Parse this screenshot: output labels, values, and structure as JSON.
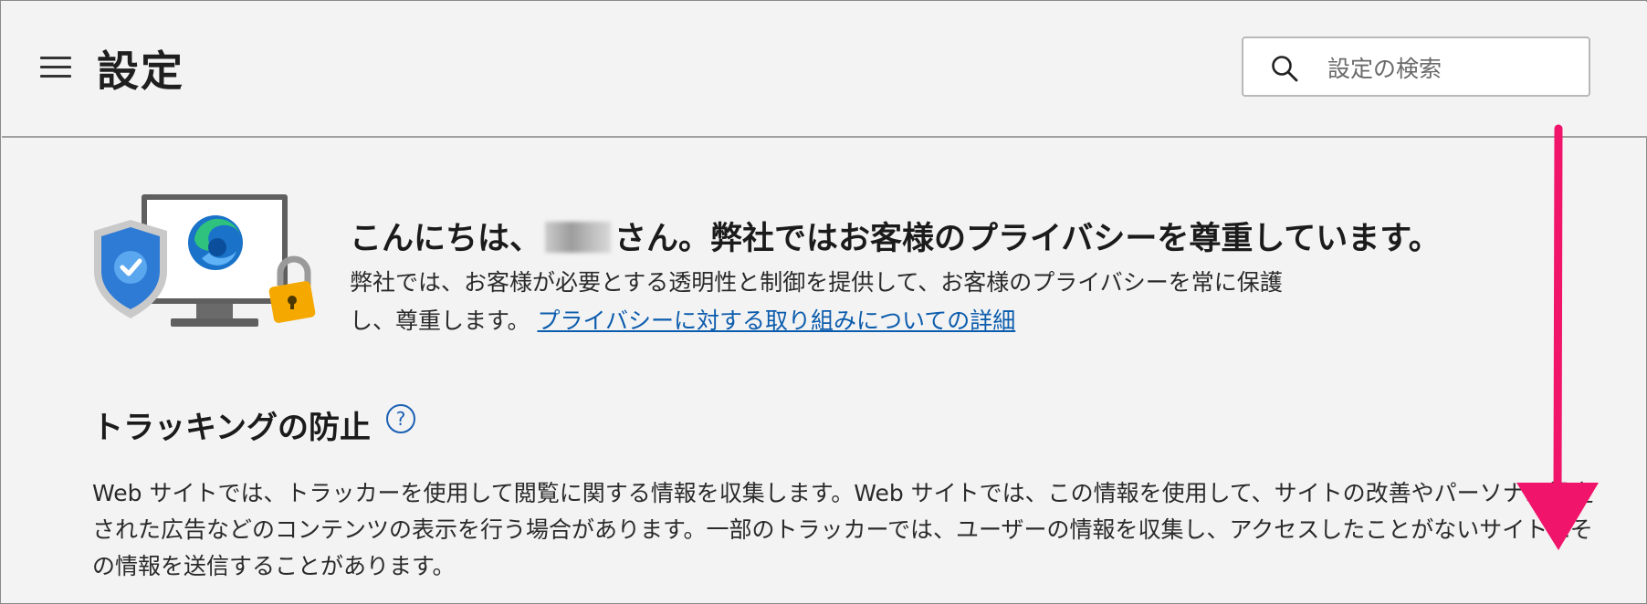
{
  "header": {
    "menu_icon": "hamburger-menu-icon",
    "title": "設定",
    "search": {
      "placeholder": "設定の検索",
      "value": "",
      "icon": "search-icon"
    }
  },
  "hero": {
    "title_before": "こんにちは、",
    "title_after": "さん。弊社ではお客様のプライバシーを尊重しています。",
    "description": "弊社では、お客様が必要とする透明性と制御を提供して、お客様のプライバシーを常に保護し、尊重します。",
    "link_text": "プライバシーに対する取り組みについての詳細",
    "illustration_icons": [
      "monitor-icon",
      "edge-logo-icon",
      "shield-check-icon",
      "padlock-icon"
    ]
  },
  "tracking": {
    "title": "トラッキングの防止",
    "help_icon": "help-circle-icon",
    "help_glyph": "?",
    "description": "Web サイトでは、トラッカーを使用して閲覧に関する情報を収集します。Web サイトでは、この情報を使用して、サイトの改善やパーソナル設定された広告などのコンテンツの表示を行う場合があります。一部のトラッカーでは、ユーザーの情報を収集し、アクセスしたことがないサイトにその情報を送信することがあります。"
  },
  "annotation": {
    "arrow_icon": "scroll-down-arrow-icon",
    "arrow_color": "#f0146a"
  },
  "colors": {
    "background": "#f3f3f3",
    "link": "#0b5cad",
    "accent_blue": "#1a5fb4",
    "arrow": "#f0146a"
  }
}
